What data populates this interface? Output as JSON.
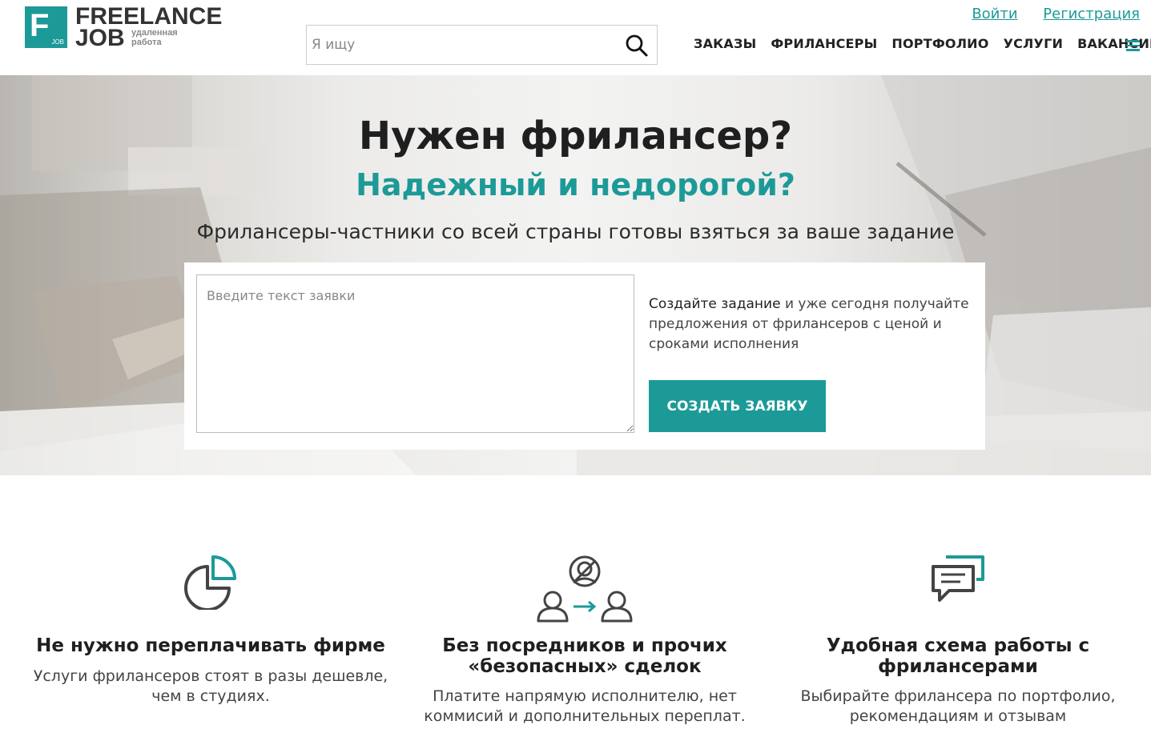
{
  "logo": {
    "letter": "F",
    "box_tag": "JOB",
    "line1": "FREELANCE",
    "line2": "JOB",
    "sub1": "удаленная",
    "sub2": "работа"
  },
  "search": {
    "placeholder": "Я ищу",
    "icon": "search-icon"
  },
  "auth": {
    "login": "Войти",
    "register": "Регистрация"
  },
  "nav": [
    {
      "label": "ЗАКАЗЫ"
    },
    {
      "label": "ФРИЛАНСЕРЫ"
    },
    {
      "label": "ПОРТФОЛИО"
    },
    {
      "label": "УСЛУГИ"
    },
    {
      "label": "ВАКАНСИИ"
    }
  ],
  "hero": {
    "title": "Нужен фрилансер?",
    "subtitle": "Надежный и недорогой?",
    "lead": "Фрилансеры-частники со всей страны готовы взяться за ваше задание",
    "textarea_placeholder": "Введите текст заявки",
    "info_highlight": "Создайте задание",
    "info_rest": " и уже сегодня получайте предложения от фрилансеров с ценой и сроками исполнения",
    "button": "СОЗДАТЬ ЗАЯВКУ"
  },
  "features": [
    {
      "icon": "pie-chart-icon",
      "title": "Не нужно переплачивать фирме",
      "text": "Услуги фрилансеров стоят в разы дешевле, чем в студиях."
    },
    {
      "icon": "no-middleman-icon",
      "title": "Без посредников и прочих «безопасных» сделок",
      "text": "Платите напрямую исполнителю, нет коммисий и дополнительных переплат."
    },
    {
      "icon": "chat-bubbles-icon",
      "title": "Удобная схема работы с фрилансерами",
      "text": "Выбирайте фрилансера по портфолио, рекомендациям и отзывам"
    }
  ],
  "colors": {
    "accent": "#1c9a98",
    "text": "#222222"
  }
}
